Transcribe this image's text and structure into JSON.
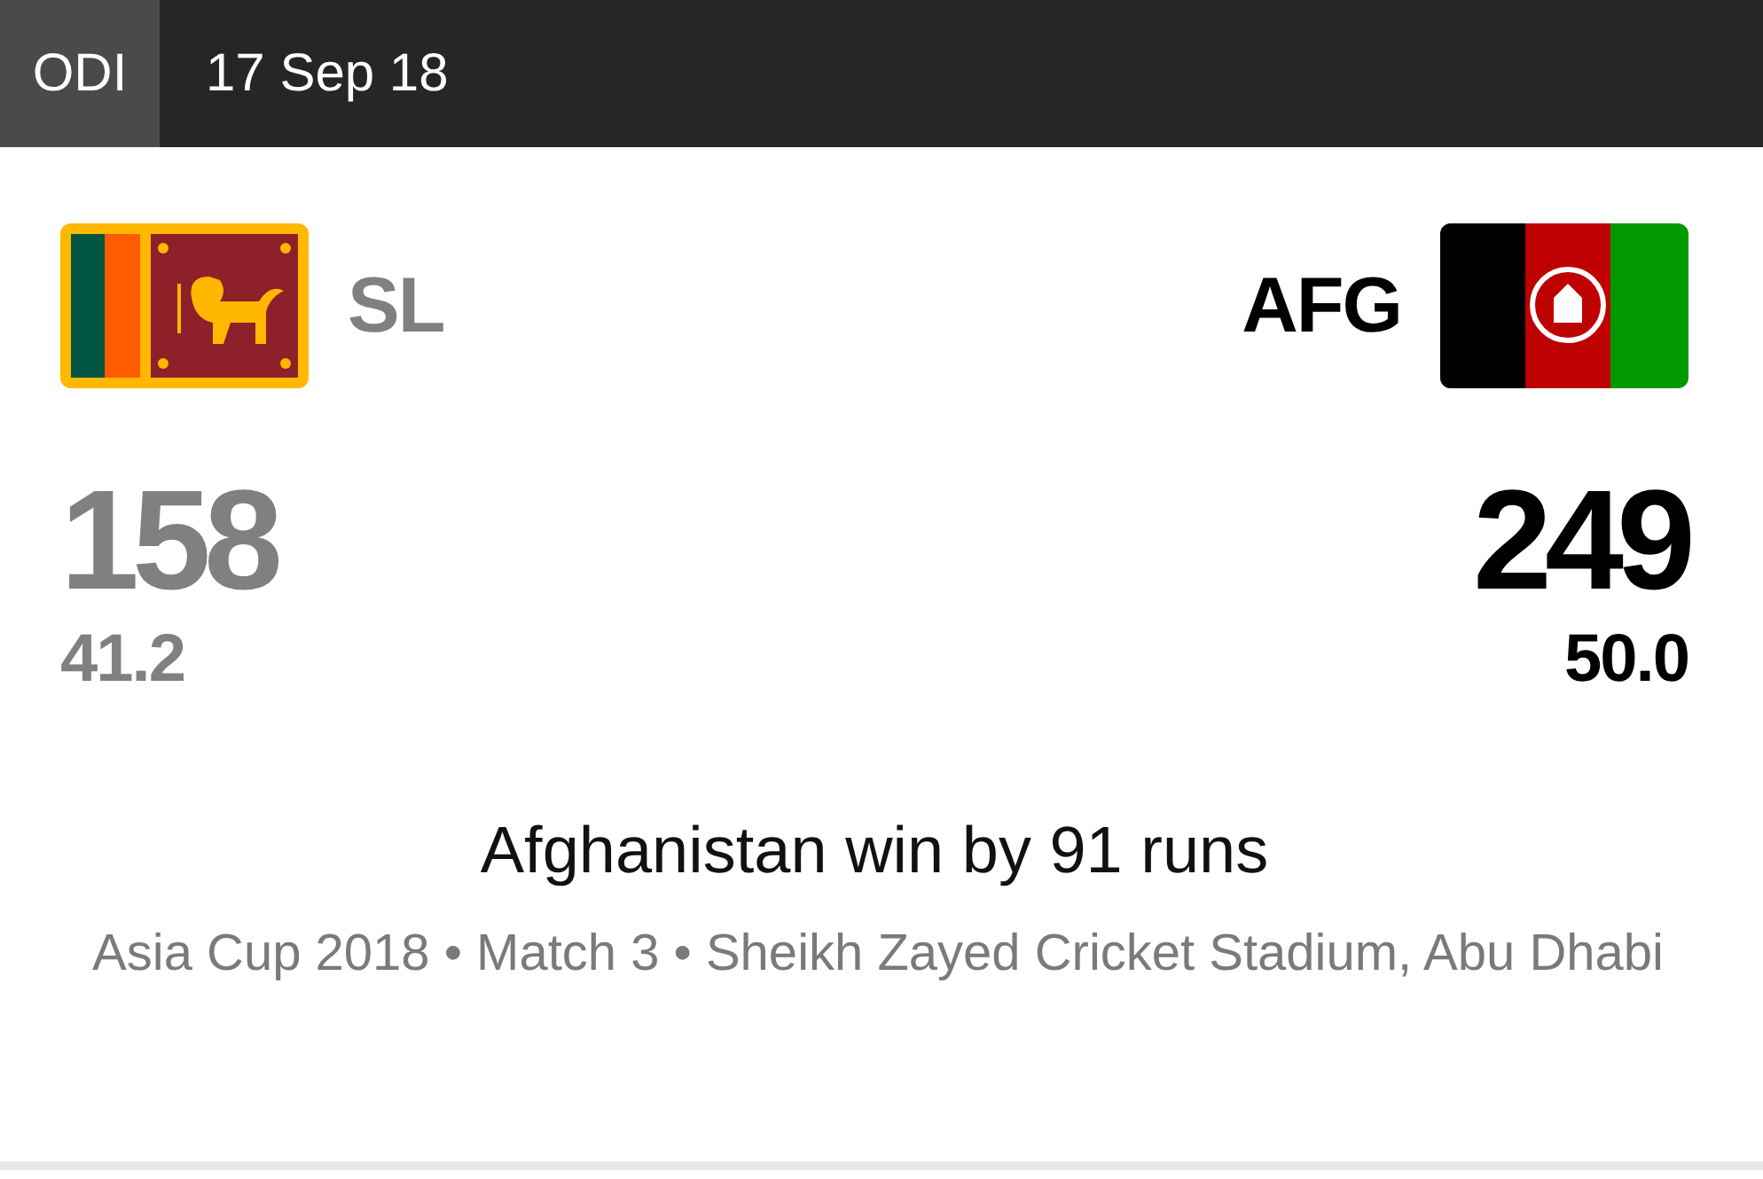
{
  "header": {
    "format": "ODI",
    "date": "17 Sep 18"
  },
  "teams": [
    {
      "abbr": "SL",
      "winner": false,
      "score": "158",
      "overs": "41.2"
    },
    {
      "abbr": "AFG",
      "winner": true,
      "score": "249",
      "overs": "50.0"
    }
  ],
  "result": "Afghanistan win by 91 runs",
  "venue": "Asia Cup 2018 • Match 3 • Sheikh Zayed Cricket Stadium, Abu Dhabi"
}
